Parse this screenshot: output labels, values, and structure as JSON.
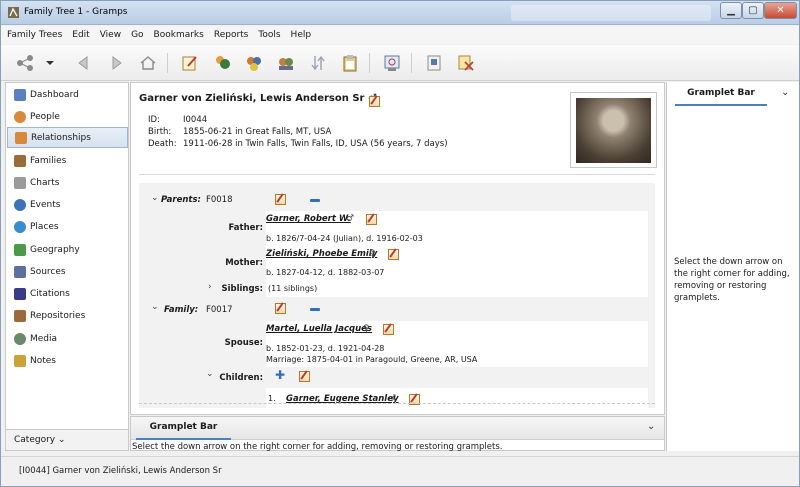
{
  "window": {
    "title": "Family Tree 1 - Gramps"
  },
  "menu": [
    "Family Trees",
    "Edit",
    "View",
    "Go",
    "Bookmarks",
    "Reports",
    "Tools",
    "Help"
  ],
  "toolbar_icons": [
    "tree-view-icon",
    "dropdown-arrow-icon",
    "back-icon",
    "forward-icon",
    "home-icon",
    "edit-icon",
    "add-person-icon",
    "add-family-icon",
    "add-parents-icon",
    "reorder-icon",
    "clipboard-icon",
    "report-icon",
    "tool-icon",
    "cut-icon"
  ],
  "sidebar": {
    "items": [
      {
        "label": "Dashboard",
        "icon": "dashboard-icon",
        "color": "#5b7fbf"
      },
      {
        "label": "People",
        "icon": "people-icon",
        "color": "#d88a3a"
      },
      {
        "label": "Relationships",
        "icon": "relationships-icon",
        "color": "#d88a3a"
      },
      {
        "label": "Families",
        "icon": "families-icon",
        "color": "#9c6b3a"
      },
      {
        "label": "Charts",
        "icon": "charts-icon",
        "color": "#7a7a7a"
      },
      {
        "label": "Events",
        "icon": "events-icon",
        "color": "#3a73b8"
      },
      {
        "label": "Places",
        "icon": "places-icon",
        "color": "#3a8dcc"
      },
      {
        "label": "Geography",
        "icon": "geography-icon",
        "color": "#4a9a4a"
      },
      {
        "label": "Sources",
        "icon": "sources-icon",
        "color": "#5b6fa0"
      },
      {
        "label": "Citations",
        "icon": "citations-icon",
        "color": "#3a3a8a"
      },
      {
        "label": "Repositories",
        "icon": "repositories-icon",
        "color": "#9a6a3a"
      },
      {
        "label": "Media",
        "icon": "media-icon",
        "color": "#6a8a6a"
      },
      {
        "label": "Notes",
        "icon": "notes-icon",
        "color": "#caa23a"
      }
    ],
    "selected": "Relationships",
    "category_label": "Category"
  },
  "person": {
    "name": "Garner von Zieliński, Lewis Anderson Sr",
    "gender_symbol": "♂",
    "id_label": "ID:",
    "id": "I0044",
    "birth_label": "Birth:",
    "birth": "1855-06-21 in Great Falls, MT, USA",
    "death_label": "Death:",
    "death": "1911-06-28 in Twin Falls, Twin Falls, ID, USA (56 years, 7 days)"
  },
  "parents": {
    "label": "Parents:",
    "id": "F0018",
    "father_label": "Father:",
    "father_name": "Garner, Robert W.",
    "father_sym": "♂",
    "father_dates": "b. 1826/7-04-24 (Julian), d. 1916-02-03",
    "mother_label": "Mother:",
    "mother_name": "Zieliński, Phoebe Emily",
    "mother_sym": "♀",
    "mother_dates": "b. 1827-04-12, d. 1882-03-07",
    "siblings_label": "Siblings:",
    "siblings": "(11 siblings)"
  },
  "family": {
    "label": "Family:",
    "id": "F0017",
    "spouse_label": "Spouse:",
    "spouse_name": "Martel, Luella Jacques",
    "spouse_sym": "♀",
    "spouse_dates": "b. 1852-01-23, d. 1921-04-28",
    "marriage": "Marriage: 1875-04-01 in Paragould, Greene, AR, USA",
    "children_label": "Children:",
    "child_index": "1.",
    "child_name": "Garner, Eugene Stanley",
    "child_sym": "♂"
  },
  "gramplet_right": {
    "tab": "Gramplet Bar",
    "text": "Select the down arrow on the right corner for adding, removing or restoring gramplets."
  },
  "gramplet_bottom": {
    "tab": "Gramplet Bar",
    "text": "Select the down arrow on the right corner for adding, removing or restoring gramplets."
  },
  "status": "[I0044] Garner von Zieliński, Lewis Anderson Sr"
}
